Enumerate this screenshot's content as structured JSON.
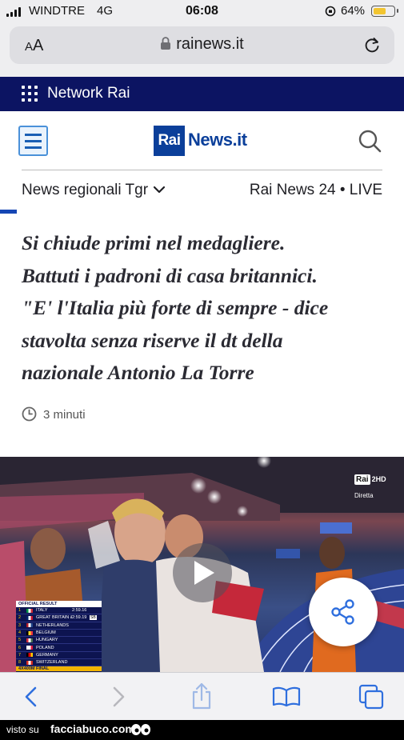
{
  "status_bar": {
    "carrier": "WINDTRE",
    "network": "4G",
    "time": "06:08",
    "battery_percent": "64%",
    "battery_level": 0.64,
    "battery_color": "#f2c531"
  },
  "browser": {
    "text_size_label_small": "A",
    "text_size_label_large": "A",
    "url": "rainews.it",
    "lock_icon": "lock-icon",
    "reload_icon": "reload-icon"
  },
  "network_band": {
    "label": "Network Rai",
    "background": "#0c1462"
  },
  "header": {
    "logo_rai": "Rai",
    "logo_news": "News.it",
    "brand_color": "#0b3f9a",
    "nav_left": "News regionali Tgr",
    "nav_right": "Rai News 24 • LIVE"
  },
  "article": {
    "title_lines": [
      "Si chiude primi nel medagliere.",
      "Battuti i padroni di casa britannici.",
      "\"E' l'Italia più forte di sempre - dice",
      "stavolta senza riserve il dt della",
      "nazionale Antonio La Torre"
    ],
    "read_time": "3 minuti"
  },
  "video": {
    "channel": "Rai",
    "channel_number": "2HD",
    "live_label": "Diretta",
    "results_header": "OFFICIAL RESULT",
    "results": [
      {
        "pos": "1",
        "country": "ITALY",
        "time": "2:59.16",
        "flag": [
          "#009246",
          "#ffffff",
          "#ce2b37"
        ]
      },
      {
        "pos": "2",
        "country": "GREAT BRITAIN & NI",
        "time": "2:59.19",
        "badge": "SB",
        "flag": [
          "#012169",
          "#ffffff",
          "#c8102e"
        ]
      },
      {
        "pos": "3",
        "country": "NETHERLANDS",
        "time": "",
        "flag": [
          "#ae1c28",
          "#ffffff",
          "#21468b"
        ]
      },
      {
        "pos": "4",
        "country": "BELGIUM",
        "time": "",
        "flag": [
          "#000000",
          "#fdda24",
          "#ef3340"
        ]
      },
      {
        "pos": "5",
        "country": "HUNGARY",
        "time": "",
        "flag": [
          "#ce2939",
          "#ffffff",
          "#477050"
        ]
      },
      {
        "pos": "6",
        "country": "POLAND",
        "time": "",
        "flag": [
          "#ffffff",
          "#ffffff",
          "#dc143c"
        ]
      },
      {
        "pos": "7",
        "country": "GERMANY",
        "time": "",
        "flag": [
          "#000000",
          "#dd0000",
          "#ffce00"
        ]
      },
      {
        "pos": "8",
        "country": "SWITZERLAND",
        "time": "",
        "flag": [
          "#d52b1e",
          "#ffffff",
          "#d52b1e"
        ]
      }
    ],
    "results_footer": "4X400M FINAL"
  },
  "toolbar": {
    "back_icon": "back-icon",
    "forward_icon": "forward-icon",
    "share_icon": "share-icon",
    "bookmarks_icon": "bookmarks-icon",
    "tabs_icon": "tabs-icon",
    "accent": "#2f6fde"
  },
  "footer": {
    "visto_su": "visto su",
    "site": "facciabuco.com"
  }
}
